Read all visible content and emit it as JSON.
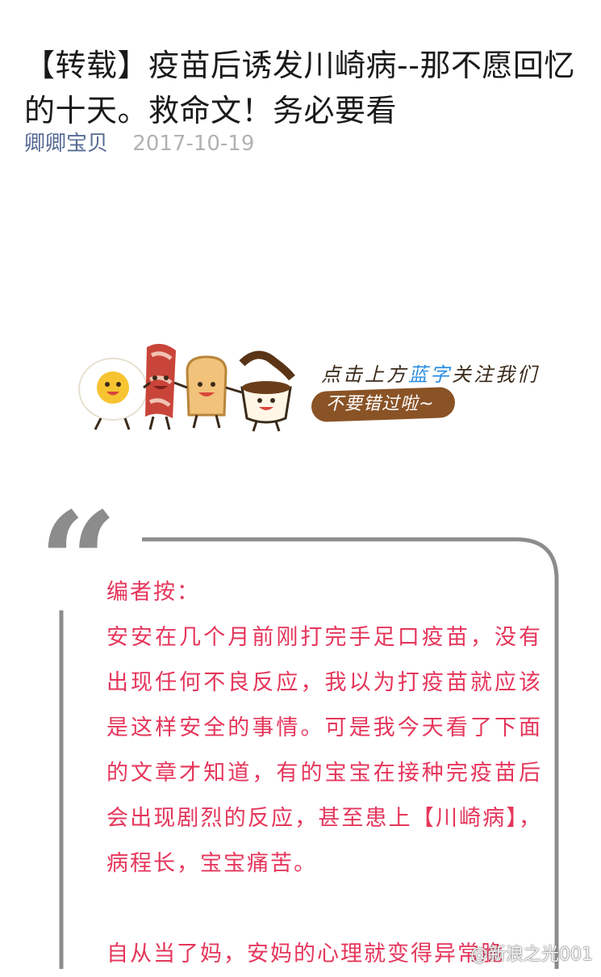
{
  "article": {
    "title": "【转载】疫苗后诱发川崎病--那不愿回忆的十天。救命文！务必要看",
    "author": "卿卿宝贝",
    "date": "2017-10-19"
  },
  "banner": {
    "follow_prefix": "点击上方",
    "follow_highlight": "蓝字",
    "follow_suffix": "关注我们",
    "follow_pill": "不要错过啦~"
  },
  "quote": {
    "mark": "“",
    "label": "编者按：",
    "paragraph1": "安安在几个月前刚打完手足口疫苗，没有出现任何不良反应，我以为打疫苗就应该是这样安全的事情。可是我今天看了下面的文章才知道，有的宝宝在接种完疫苗后会出现剧烈的反应，甚至患上【川崎病】，病程长，宝宝痛苦。",
    "paragraph2": "自从当了妈，安妈的心理就变得异常脆"
  },
  "watermark": "@新浪之光001",
  "colors": {
    "title": "#1a1a1a",
    "author": "#576b95",
    "date": "#b2b2b2",
    "quote_text": "#e5365b",
    "frame": "#8c8c8c",
    "pill": "#8a5326",
    "highlight": "#2b8ee0"
  }
}
